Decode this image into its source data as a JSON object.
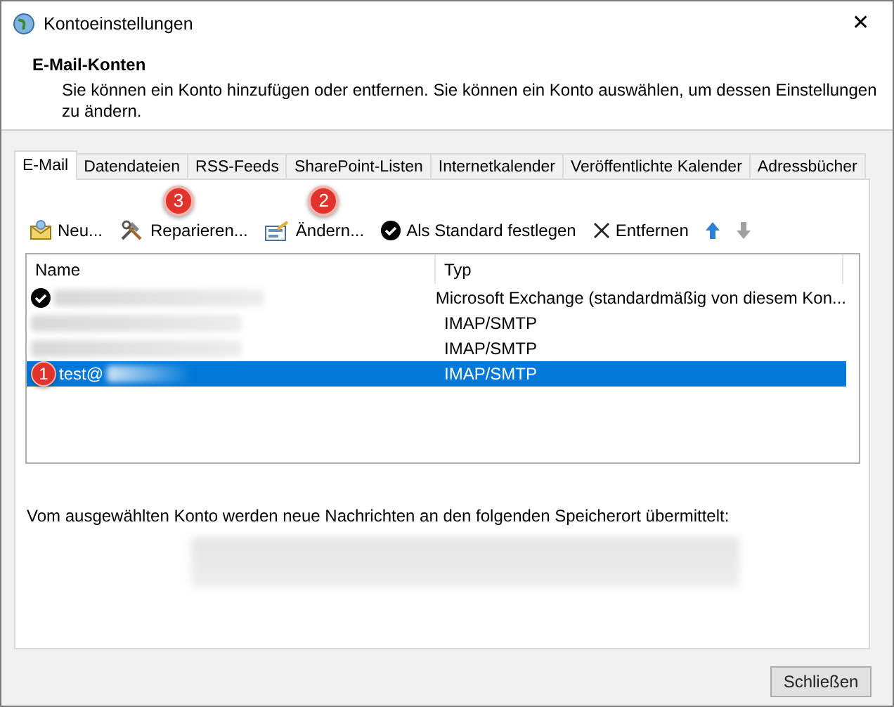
{
  "window": {
    "title": "Kontoeinstellungen",
    "close": "✕"
  },
  "header": {
    "title": "E-Mail-Konten",
    "description": "Sie können ein Konto hinzufügen oder entfernen. Sie können ein Konto auswählen, um dessen Einstellungen zu ändern."
  },
  "tabs": [
    {
      "label": "E-Mail",
      "selected": true
    },
    {
      "label": "Datendateien",
      "selected": false
    },
    {
      "label": "RSS-Feeds",
      "selected": false
    },
    {
      "label": "SharePoint-Listen",
      "selected": false
    },
    {
      "label": "Internetkalender",
      "selected": false
    },
    {
      "label": "Veröffentlichte Kalender",
      "selected": false
    },
    {
      "label": "Adressbücher",
      "selected": false
    }
  ],
  "toolbar": [
    {
      "kind": "new",
      "label": "Neu...",
      "disabled": false
    },
    {
      "kind": "repair",
      "label": "Reparieren...",
      "disabled": false,
      "callout": "3"
    },
    {
      "kind": "change",
      "label": "Ändern...",
      "disabled": false,
      "callout": "2"
    },
    {
      "kind": "default",
      "label": "Als Standard festlegen",
      "disabled": false
    },
    {
      "kind": "remove",
      "label": "Entfernen",
      "disabled": false
    },
    {
      "kind": "up",
      "disabled": false
    },
    {
      "kind": "down",
      "disabled": true
    }
  ],
  "table": {
    "columns": [
      "Name",
      "Typ"
    ],
    "rows": [
      {
        "default": true,
        "name_visible": "",
        "type": "Microsoft Exchange (standardmäßig von diesem Kon...",
        "selected": false
      },
      {
        "default": false,
        "name_visible": "",
        "type": "IMAP/SMTP",
        "selected": false
      },
      {
        "default": false,
        "name_visible": "",
        "type": "IMAP/SMTP",
        "selected": false
      },
      {
        "default": false,
        "name_visible": "test@",
        "type": "IMAP/SMTP",
        "selected": true,
        "callout": "1"
      }
    ]
  },
  "delivery": {
    "text": "Vom ausgewählten Konto werden neue Nachrichten an den folgenden Speicherort übermittelt:"
  },
  "buttons": [
    {
      "label": "Schließen"
    }
  ]
}
